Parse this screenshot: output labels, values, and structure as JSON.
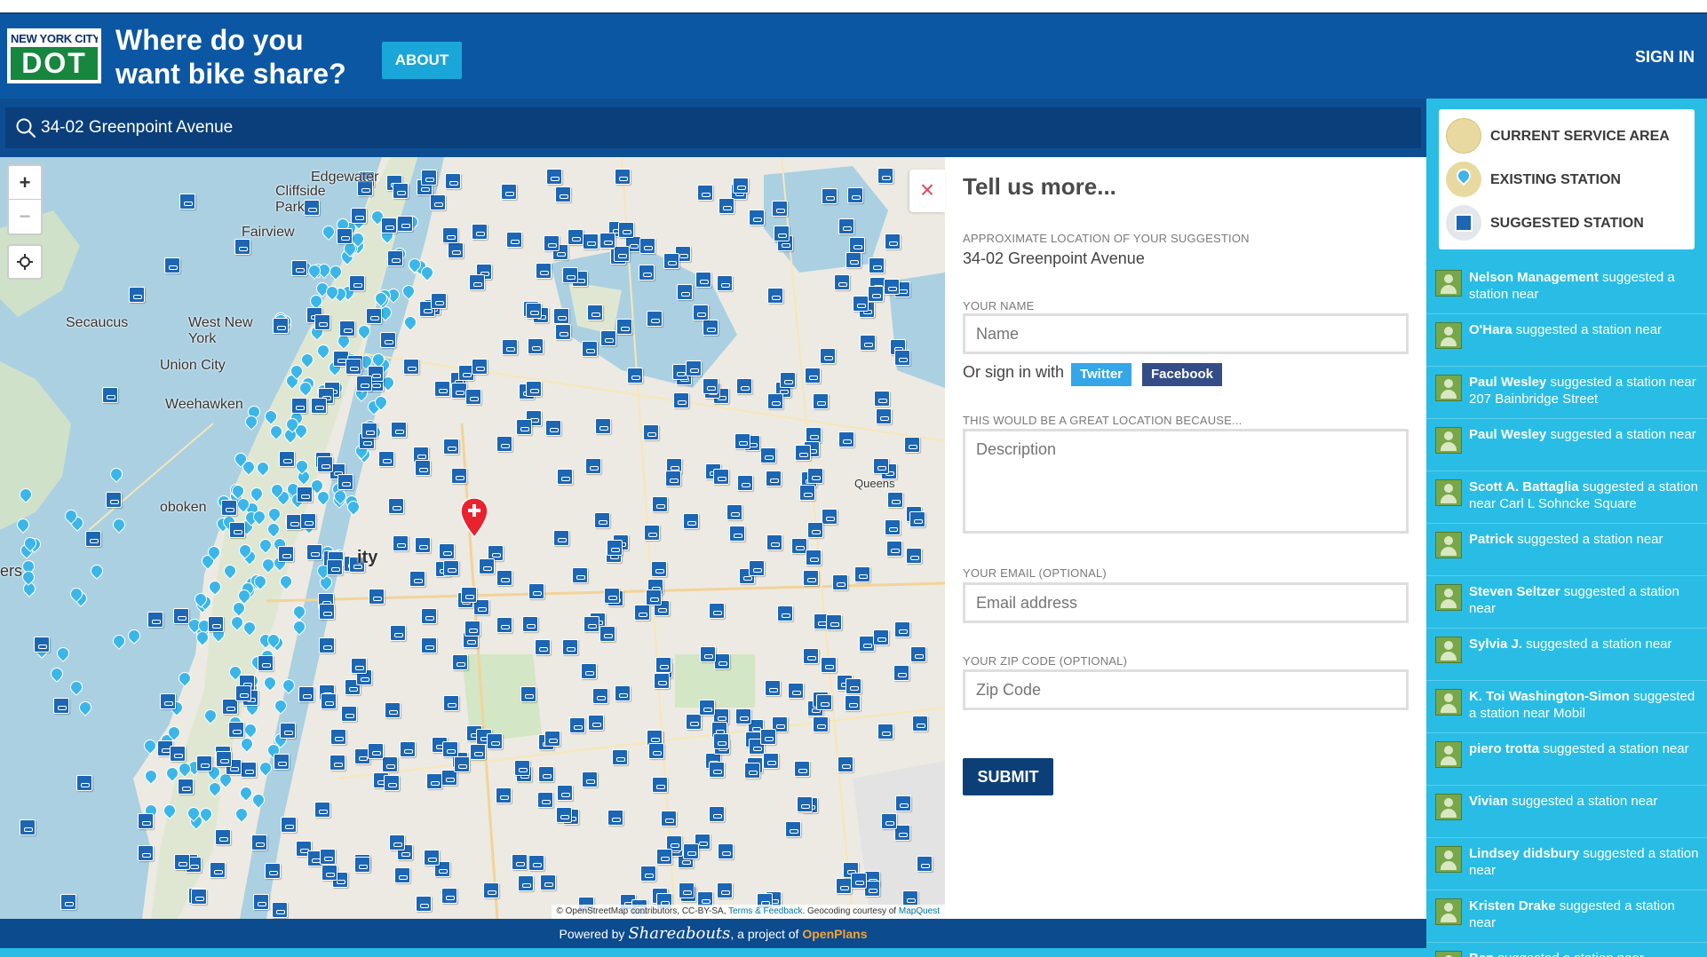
{
  "header": {
    "logo_top": "NEW YORK CITY",
    "logo_bottom": "DOT",
    "title_line1": "Where do you",
    "title_line2": "want bike share?",
    "about_label": "ABOUT",
    "signin_label": "SIGN IN"
  },
  "search": {
    "value": "34-02 Greenpoint Avenue",
    "icon": "search-icon"
  },
  "map": {
    "places": [
      "Edgewater",
      "Cliffside Park",
      "Fairview",
      "Secaucus",
      "West New York",
      "Union City",
      "Weehawken",
      "oboken",
      "Queens",
      "ity",
      "ers"
    ],
    "zoom_in": "+",
    "zoom_out": "−",
    "attribution": "© OpenStreetMap contributors, CC-BY-SA,",
    "attribution_terms": "Terms & Feedback",
    "attribution_geo": ". Geocoding courtesy of",
    "attribution_mq": "MapQuest"
  },
  "form": {
    "title": "Tell us more...",
    "location_label": "APPROXIMATE LOCATION OF YOUR SUGGESTION",
    "location_value": "34-02 Greenpoint Avenue",
    "name_label": "YOUR NAME",
    "name_placeholder": "Name",
    "signin_text": "Or sign in with",
    "twitter_label": "Twitter",
    "facebook_label": "Facebook",
    "reason_label": "THIS WOULD BE A GREAT LOCATION BECAUSE...",
    "reason_placeholder": "Description",
    "email_label": "YOUR EMAIL (OPTIONAL)",
    "email_placeholder": "Email address",
    "zip_label": "YOUR ZIP CODE (OPTIONAL)",
    "zip_placeholder": "Zip Code",
    "submit_label": "SUBMIT",
    "close_symbol": "×"
  },
  "legend": [
    {
      "label": "CURRENT SERVICE AREA",
      "icon": "service-area-icon",
      "color": "#e8d9a0"
    },
    {
      "label": "EXISTING STATION",
      "icon": "existing-station-icon",
      "color": "#3cb6e8"
    },
    {
      "label": "SUGGESTED STATION",
      "icon": "suggested-station-icon",
      "color": "#1c66b4"
    }
  ],
  "activity": [
    {
      "name": "Nelson Management",
      "text": "suggested a station near"
    },
    {
      "name": "O'Hara",
      "text": "suggested a station near"
    },
    {
      "name": "Paul Wesley",
      "text": "suggested a station near 207 Bainbridge Street"
    },
    {
      "name": "Paul Wesley",
      "text": "suggested a station near"
    },
    {
      "name": "Scott A. Battaglia",
      "text": "suggested a station near Carl L Sohncke Square"
    },
    {
      "name": "Patrick",
      "text": "suggested a station near"
    },
    {
      "name": "Steven Seltzer",
      "text": "suggested a station near"
    },
    {
      "name": "Sylvia J.",
      "text": "suggested a station near"
    },
    {
      "name": "K. Toi Washington-Simon",
      "text": "suggested a station near Mobil"
    },
    {
      "name": "piero trotta",
      "text": "suggested a station near"
    },
    {
      "name": "Vivian",
      "text": "suggested a station near"
    },
    {
      "name": "Lindsey didsbury",
      "text": "suggested a station near"
    },
    {
      "name": "Kristen Drake",
      "text": "suggested a station near"
    },
    {
      "name": "Ben",
      "text": "suggested a station near"
    }
  ],
  "footer": {
    "powered": "Powered by",
    "brand": "Shareabouts",
    "project": ", a project of",
    "openplans": "OpenPlans"
  },
  "colors": {
    "header_blue": "#0c57a3",
    "sidebar_cyan": "#29bde5",
    "suggested_marker": "#1c66b4",
    "existing_marker": "#3cb6e8",
    "pin_red": "#e8232f"
  }
}
